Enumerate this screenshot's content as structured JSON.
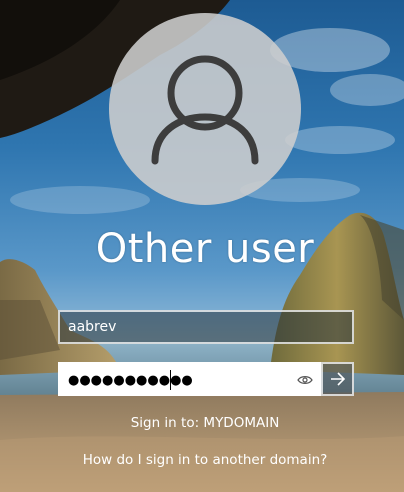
{
  "login": {
    "user_display_name": "Other user",
    "username_value": "aabrev",
    "password_masked": "●●●●●●●●●●●",
    "sign_in_to_text": "Sign in to: MYDOMAIN",
    "other_domain_link": "How do I sign in to another domain?"
  },
  "icons": {
    "avatar": "user-silhouette-icon",
    "reveal": "eye-icon",
    "submit": "arrow-right-icon"
  },
  "colors": {
    "sky": "#2f76b0",
    "avatar_bg": "#cecece",
    "field_border": "#ffffff"
  }
}
